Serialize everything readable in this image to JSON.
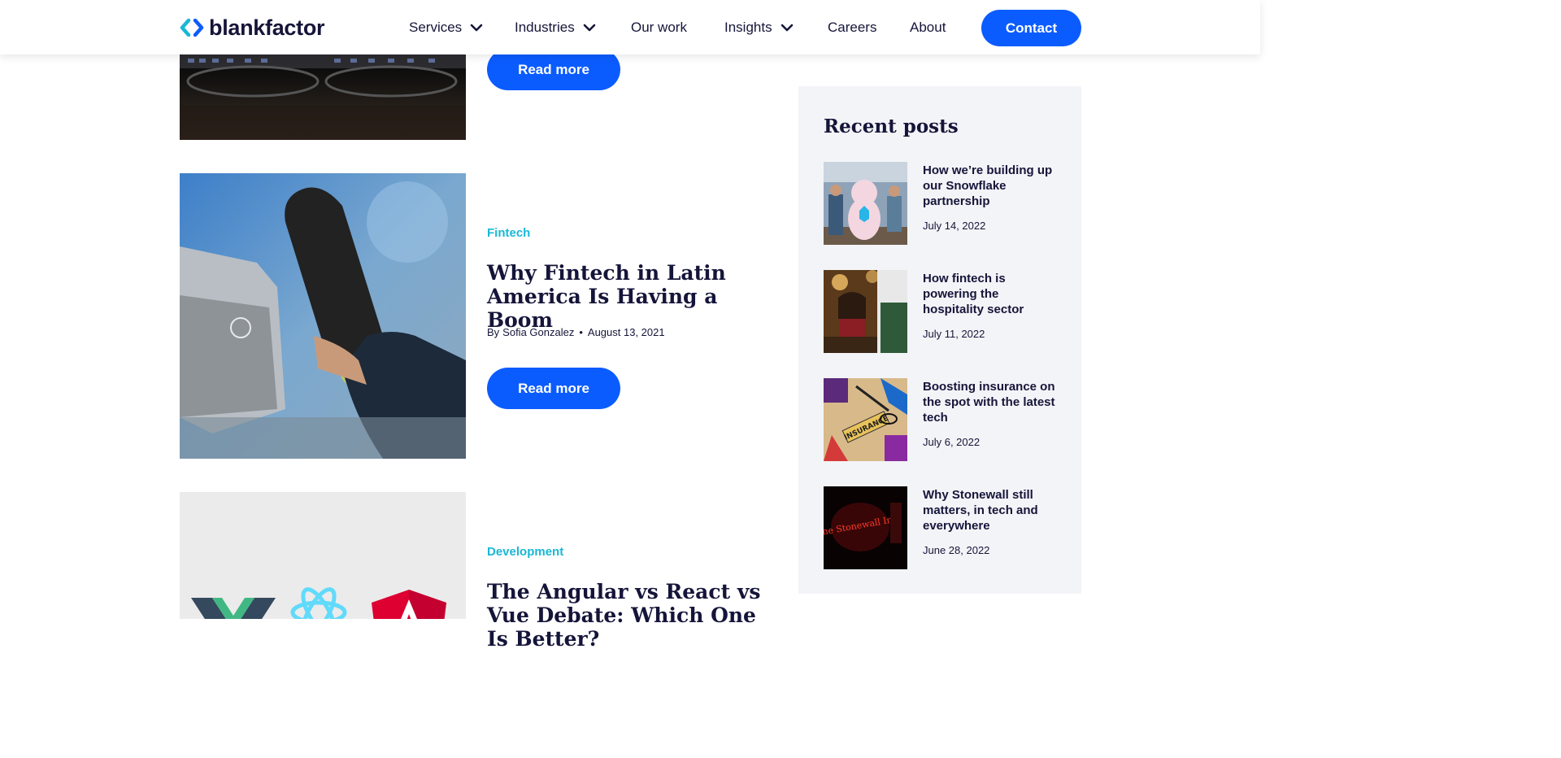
{
  "header": {
    "brand": "blankfactor",
    "nav": [
      {
        "label": "Services",
        "dropdown": true
      },
      {
        "label": "Industries",
        "dropdown": true
      },
      {
        "label": "Our work",
        "dropdown": false
      },
      {
        "label": "Insights",
        "dropdown": true
      },
      {
        "label": "Careers",
        "dropdown": false
      },
      {
        "label": "About",
        "dropdown": false
      }
    ],
    "contact_label": "Contact"
  },
  "articles": [
    {
      "read_more": "Read more"
    },
    {
      "category": "Fintech",
      "title": "Why Fintech in Latin America Is Having a Boom",
      "by": "By",
      "author": "Sofia Gonzalez",
      "separator": "•",
      "date": "August 13, 2021",
      "read_more": "Read more"
    },
    {
      "category": "Development",
      "title": "The Angular vs React vs Vue Debate: Which One Is Better?"
    }
  ],
  "sidebar": {
    "title": "Recent posts",
    "posts": [
      {
        "title": "How we’re building up our Snowflake partnership",
        "date": "July 14, 2022"
      },
      {
        "title": "How fintech is powering the hospitality sector",
        "date": "July 11, 2022"
      },
      {
        "title": "Boosting insurance on the spot with the latest tech",
        "date": "July 6, 2022"
      },
      {
        "title": "Why Stonewall still matters, in tech and everywhere",
        "date": "June 28, 2022"
      }
    ],
    "image_text": {
      "insurance": "INSURANCE",
      "stonewall": "The Stonewall Inn"
    }
  },
  "colors": {
    "brand_blue": "#0b5cff",
    "accent_cyan": "#19b8d6",
    "navy": "#15153a",
    "sidebar_bg": "#f3f4f7"
  },
  "icons": [
    "blankfactor-logo-icon",
    "chevron-down-icon"
  ]
}
